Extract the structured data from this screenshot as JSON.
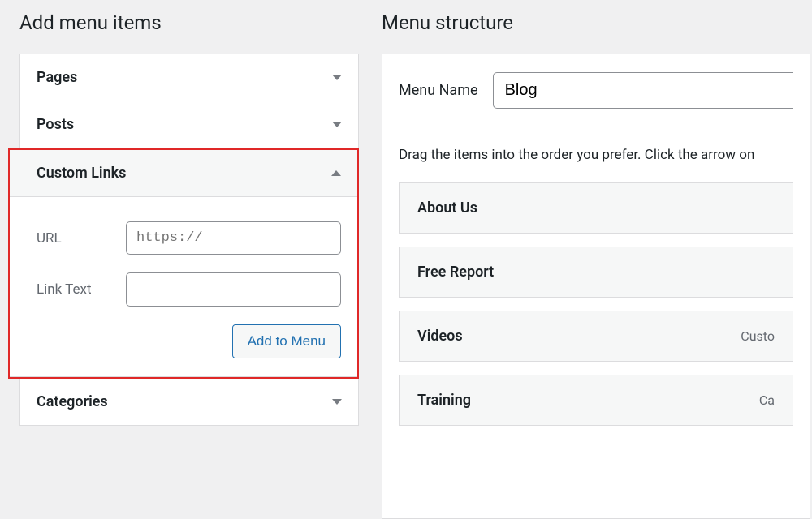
{
  "left": {
    "heading": "Add menu items",
    "accordion": {
      "pages": "Pages",
      "posts": "Posts",
      "custom_links": {
        "title": "Custom Links",
        "url_label": "URL",
        "url_placeholder": "https://",
        "link_text_label": "Link Text",
        "add_button": "Add to Menu"
      },
      "categories": "Categories"
    }
  },
  "right": {
    "heading": "Menu structure",
    "menu_name_label": "Menu Name",
    "menu_name_value": "Blog",
    "instructions": "Drag the items into the order you prefer. Click the arrow on",
    "items": [
      {
        "title": "About Us",
        "type": ""
      },
      {
        "title": "Free Report",
        "type": ""
      },
      {
        "title": "Videos",
        "type": "Custo"
      },
      {
        "title": "Training",
        "type": "Ca"
      }
    ]
  }
}
